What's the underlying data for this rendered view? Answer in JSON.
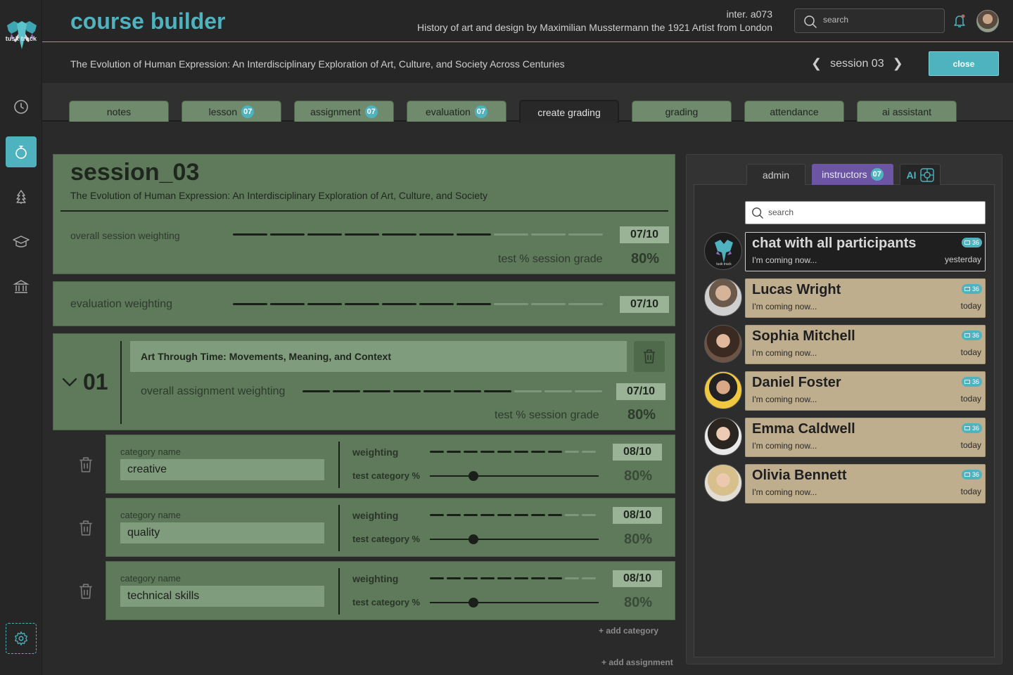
{
  "app": {
    "title": "course builder",
    "logo_text": "tusk track",
    "inter_code": "inter. a073",
    "course_description": "History of art and design by Maximilian Musstermann the 1921 Artist from London",
    "search_placeholder": "search"
  },
  "subheader": {
    "course_title": "The Evolution of Human Expression: An Interdisciplinary Exploration of Art, Culture, and Society Across Centuries",
    "session_label": "session 03",
    "close_label": "close"
  },
  "tabs": [
    {
      "label": "notes",
      "badge": ""
    },
    {
      "label": "lesson",
      "badge": "07"
    },
    {
      "label": "assignment",
      "badge": "07"
    },
    {
      "label": "evaluation",
      "badge": "07"
    },
    {
      "label": "create grading",
      "badge": ""
    },
    {
      "label": "grading",
      "badge": ""
    },
    {
      "label": "attendance",
      "badge": ""
    },
    {
      "label": "ai assistant",
      "badge": ""
    }
  ],
  "session": {
    "heading": "session_03",
    "subtitle": "The Evolution of Human Expression: An Interdisciplinary Exploration of Art, Culture, and Society",
    "weighting_label": "overall session weighting",
    "weighting_value": "07/10",
    "weighting_level": 7,
    "grade_label": "test % session grade",
    "grade_value": "80%"
  },
  "evaluation": {
    "weighting_label": "evaluation weighting",
    "weighting_value": "07/10",
    "weighting_level": 7
  },
  "assignment": {
    "number": "01",
    "title": "Art Through Time: Movements, Meaning, and Context",
    "weighting_label": "overall assignment weighting",
    "weighting_value": "07/10",
    "weighting_level": 7,
    "grade_label": "test % session grade",
    "grade_value": "80%"
  },
  "categories": [
    {
      "name_label": "category name",
      "name": "creative",
      "weight_label": "weighting",
      "weight_value": "08/10",
      "weight_level": 8,
      "pct_label": "test category %",
      "pct_value": "80%",
      "slider": 0.26
    },
    {
      "name_label": "category name",
      "name": "quality",
      "weight_label": "weighting",
      "weight_value": "08/10",
      "weight_level": 8,
      "pct_label": "test category %",
      "pct_value": "80%",
      "slider": 0.26
    },
    {
      "name_label": "category name",
      "name": "technical skills",
      "weight_label": "weighting",
      "weight_value": "08/10",
      "weight_level": 8,
      "pct_label": "test category %",
      "pct_value": "80%",
      "slider": 0.26
    }
  ],
  "links": {
    "add_category": "+ add category",
    "add_assignment": "+ add assignment"
  },
  "right_panel": {
    "tab_admin": "admin",
    "tab_instructors": "instructors",
    "tab_instructors_badge": "07",
    "tab_ai": "AI",
    "search_placeholder": "search",
    "chats": [
      {
        "name": "chat with all participants",
        "message": "I'm coming now...",
        "time": "yesterday",
        "count": "36"
      },
      {
        "name": "Lucas Wright",
        "message": "I'm coming now...",
        "time": "today",
        "count": "36"
      },
      {
        "name": "Sophia Mitchell",
        "message": "I'm coming now...",
        "time": "today",
        "count": "36"
      },
      {
        "name": "Daniel Foster",
        "message": "I'm coming now...",
        "time": "today",
        "count": "36"
      },
      {
        "name": "Emma Caldwell",
        "message": "I'm coming now...",
        "time": "today",
        "count": "36"
      },
      {
        "name": "Olivia Bennett",
        "message": "I'm coming now...",
        "time": "today",
        "count": "36"
      }
    ]
  },
  "colors": {
    "accent": "#4fb3bf",
    "card_green": "#5e7a5b",
    "chat_tan": "#bfae8e",
    "instructors_purple": "#6c55a3"
  }
}
